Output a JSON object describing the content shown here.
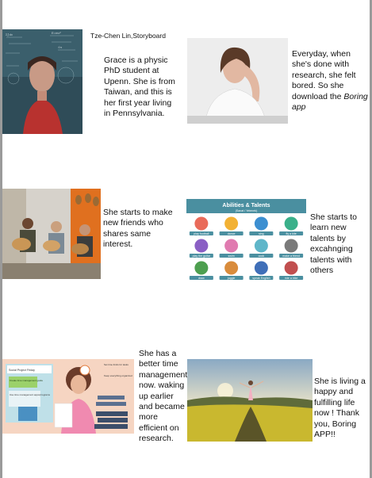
{
  "author": "Tze-Chen Lin,Storyboard",
  "panels": [
    {
      "text": "Grace is a physic PhD student at Upenn. She is from Taiwan, and this is her first year living in Pennsylvania."
    },
    {
      "text_before": "Everyday, when she's done with research, she felt bored. So she download the ",
      "app_name": "Boring app"
    },
    {
      "text": "She starts to make new friends who shares same interest."
    },
    {
      "text": "She starts to learn new talents by excahnging talents with others"
    },
    {
      "text": "She has a better time management now. waking up earlier and became more efficient on research."
    },
    {
      "text": "She is living a happy and fulfilling life now ! Thank you, Boring APP!!"
    }
  ],
  "talents_graphic": {
    "title": "Abilities & Talents",
    "subtitle": "(Sanat / Yetenek)",
    "items": [
      "play football",
      "dance",
      "sing",
      "fly a kite",
      "play the guitar",
      "swim",
      "cook",
      "make a friend",
      "draw",
      "juggle",
      "speak English",
      "ride a bike"
    ]
  },
  "time_graphic": {
    "notes": [
      "Social Project Friday",
      "Create time management guide",
      "Use time management apps/programs",
      "Set time limits for tasks",
      "Keep everything organized"
    ]
  },
  "colors": {
    "talents_header": "#4a8fa0",
    "background_gray": "#9a9a9a"
  }
}
